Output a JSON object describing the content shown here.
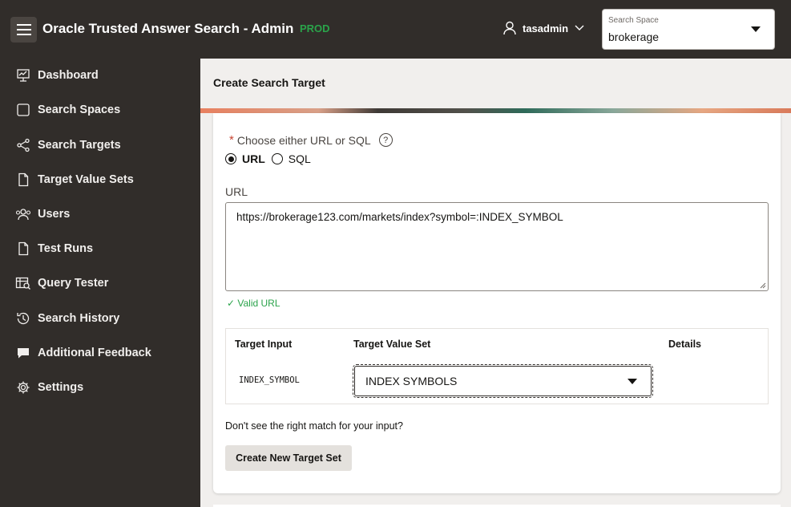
{
  "header": {
    "app_title": "Oracle Trusted Answer Search - Admin",
    "env_badge": "PROD",
    "username": "tasadmin",
    "search_space_label": "Search Space",
    "search_space_value": "brokerage"
  },
  "sidebar": {
    "items": [
      {
        "label": "Dashboard",
        "icon": "presentation-icon"
      },
      {
        "label": "Search Spaces",
        "icon": "square-icon"
      },
      {
        "label": "Search Targets",
        "icon": "share-icon"
      },
      {
        "label": "Target Value Sets",
        "icon": "document-icon"
      },
      {
        "label": "Users",
        "icon": "users-icon"
      },
      {
        "label": "Test Runs",
        "icon": "document-icon"
      },
      {
        "label": "Query Tester",
        "icon": "table-search-icon"
      },
      {
        "label": "Search History",
        "icon": "history-icon"
      },
      {
        "label": "Additional Feedback",
        "icon": "chat-bubble-icon"
      },
      {
        "label": "Settings",
        "icon": "gear-icon"
      }
    ]
  },
  "main": {
    "page_title": "Create Search Target",
    "form": {
      "required_mark": "*",
      "choose_label": "Choose either URL or SQL",
      "help_glyph": "?",
      "option_url": "URL",
      "option_sql": "SQL",
      "selected_option": "URL",
      "url_label": "URL",
      "url_value": "https://brokerage123.com/markets/index?symbol=:INDEX_SYMBOL",
      "valid_message": "✓ Valid URL"
    },
    "table": {
      "headers": [
        "Target Input",
        "Target Value Set",
        "Details"
      ],
      "rows": [
        {
          "target_input": "INDEX_SYMBOL",
          "target_value_set": "INDEX SYMBOLS",
          "details": ""
        }
      ]
    },
    "hint": "Don't see the right match for your input?",
    "create_button": "Create New Target Set"
  },
  "colors": {
    "header_bg": "#312d2a",
    "sidebar_bg": "#312d2a",
    "env_badge": "#2aa34a",
    "valid": "#2aa34a",
    "required": "#c74634"
  }
}
